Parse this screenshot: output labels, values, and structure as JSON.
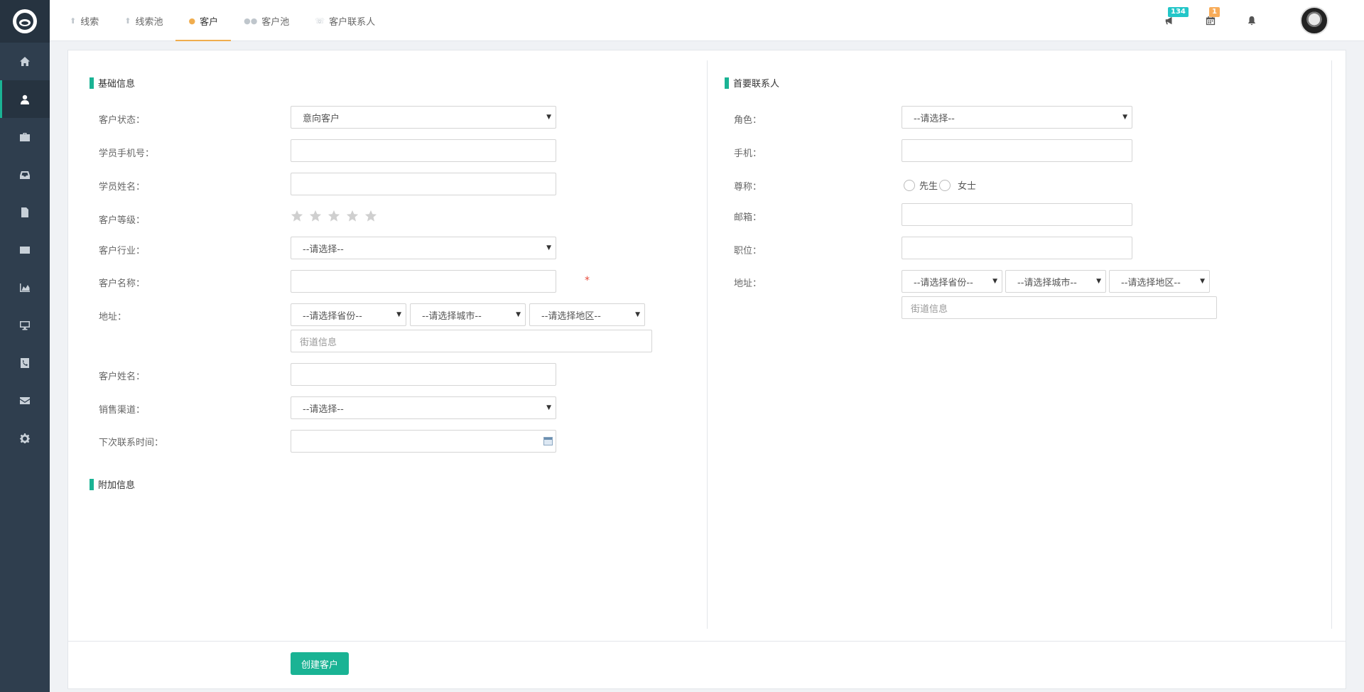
{
  "sidebar": {
    "items": [
      {
        "icon": "home-icon"
      },
      {
        "icon": "user-icon"
      },
      {
        "icon": "briefcase-icon"
      },
      {
        "icon": "inbox-icon"
      },
      {
        "icon": "document-icon"
      },
      {
        "icon": "credit-card-icon"
      },
      {
        "icon": "area-chart-icon"
      },
      {
        "icon": "desktop-icon"
      },
      {
        "icon": "phone-icon"
      },
      {
        "icon": "envelope-icon"
      },
      {
        "icon": "gear-icon"
      }
    ]
  },
  "tabs": [
    {
      "label": "线索"
    },
    {
      "label": "线索池"
    },
    {
      "label": "客户"
    },
    {
      "label": "客户池"
    },
    {
      "label": "客户联系人"
    }
  ],
  "topbar": {
    "messages_badge": "134",
    "calendar_badge": "1"
  },
  "basic": {
    "title": "基础信息",
    "status_label": "客户状态：",
    "status_value": "意向客户",
    "phone_label": "学员手机号：",
    "student_name_label": "学员姓名：",
    "level_label": "客户等级：",
    "industry_label": "客户行业：",
    "industry_value": "--请选择--",
    "customer_name_label": "客户名称：",
    "required_mark": "*",
    "address_label": "地址：",
    "province_value": "--请选择省份--",
    "city_value": "--请选择城市--",
    "district_value": "--请选择地区--",
    "street_placeholder": "街道信息",
    "customer_person_label": "客户姓名：",
    "channel_label": "销售渠道：",
    "channel_value": "--请选择--",
    "next_contact_label": "下次联系时间："
  },
  "extra": {
    "title": "附加信息"
  },
  "contact": {
    "title": "首要联系人",
    "role_label": "角色：",
    "role_value": "--请选择--",
    "mobile_label": "手机：",
    "salutation_label": "尊称：",
    "mr": "先生",
    "ms": "女士",
    "email_label": "邮箱：",
    "position_label": "职位：",
    "address_label": "地址：",
    "province_value": "--请选择省份--",
    "city_value": "--请选择城市--",
    "district_value": "--请选择地区--",
    "street_placeholder": "街道信息"
  },
  "actions": {
    "create_label": "创建客户"
  },
  "colors": {
    "accent": "#1ab394",
    "sidebar": "#2f3e4e",
    "active_tab": "#f0ad4e"
  }
}
